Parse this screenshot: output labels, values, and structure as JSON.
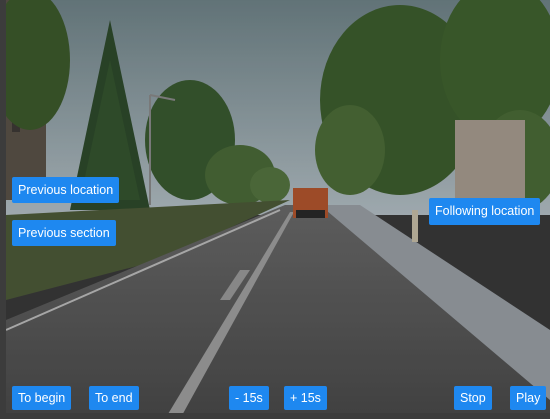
{
  "nav": {
    "previous_location": "Previous location",
    "previous_section": "Previous section",
    "following_location": "Following location"
  },
  "controls": {
    "to_begin": "To begin",
    "to_end": "To end",
    "back_15": "- 15s",
    "forward_15": "+ 15s",
    "stop": "Stop",
    "play": "Play"
  },
  "colors": {
    "button": "#1e88f0",
    "button_text": "#ffffff"
  }
}
